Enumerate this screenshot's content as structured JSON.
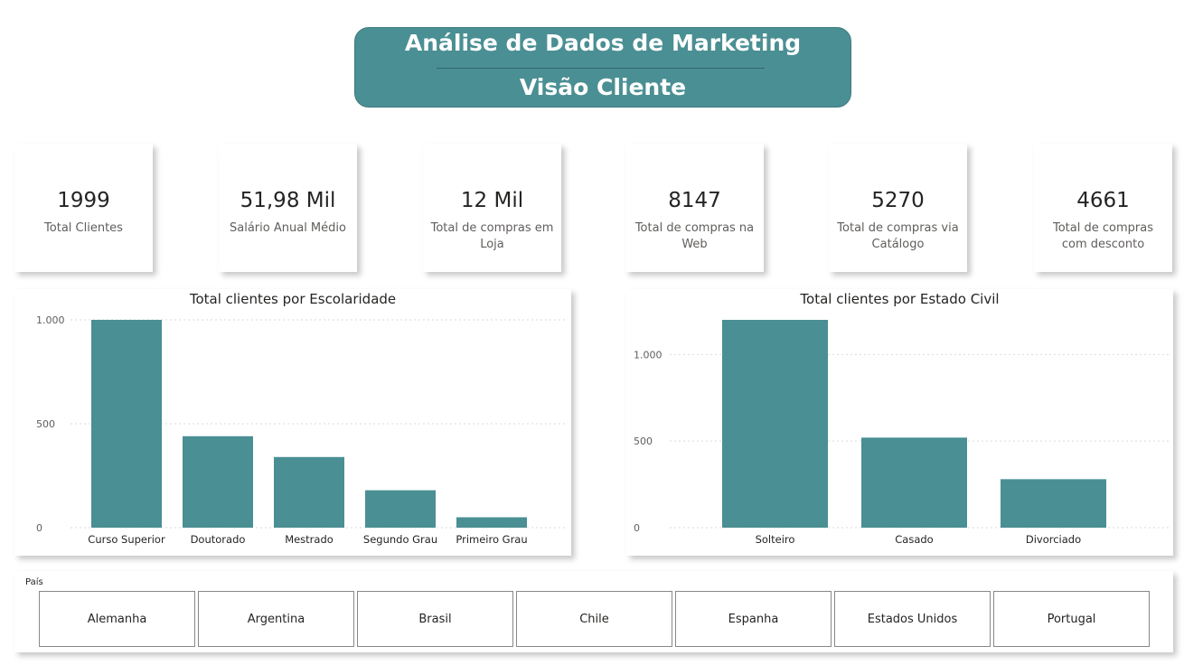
{
  "header": {
    "title": "Análise de Dados de Marketing",
    "subtitle": "Visão Cliente"
  },
  "kpis": [
    {
      "value": "1999",
      "label": "Total Clientes"
    },
    {
      "value": "51,98 Mil",
      "label": "Salário Anual Médio"
    },
    {
      "value": "12 Mil",
      "label": "Total de compras em Loja"
    },
    {
      "value": "8147",
      "label": "Total de compras na Web"
    },
    {
      "value": "5270",
      "label": "Total de compras via Catálogo"
    },
    {
      "value": "4661",
      "label": "Total de compras com desconto"
    }
  ],
  "chart_data": [
    {
      "type": "bar",
      "title": "Total clientes por Escolaridade",
      "categories": [
        "Curso Superior",
        "Doutorado",
        "Mestrado",
        "Segundo Grau",
        "Primeiro Grau"
      ],
      "values": [
        1000,
        440,
        340,
        180,
        50
      ],
      "ylim": [
        0,
        1000
      ],
      "yticks": [
        0,
        500,
        1000
      ],
      "ytick_labels": [
        "0",
        "500",
        "1.000"
      ],
      "xlabel": "",
      "ylabel": "",
      "color": "#4a8f93",
      "grid": true
    },
    {
      "type": "bar",
      "title": "Total clientes por Estado Civil",
      "categories": [
        "Solteiro",
        "Casado",
        "Divorciado"
      ],
      "values": [
        1200,
        520,
        280
      ],
      "ylim": [
        0,
        1200
      ],
      "yticks": [
        0,
        500,
        1000
      ],
      "ytick_labels": [
        "0",
        "500",
        "1.000"
      ],
      "xlabel": "",
      "ylabel": "",
      "color": "#4a8f93",
      "grid": true
    }
  ],
  "slicer": {
    "title": "País",
    "options": [
      "Alemanha",
      "Argentina",
      "Brasil",
      "Chile",
      "Espanha",
      "Estados Unidos",
      "Portugal"
    ]
  },
  "colors": {
    "accent": "#4a8f93",
    "text": "#252423",
    "muted": "#605e5c"
  }
}
